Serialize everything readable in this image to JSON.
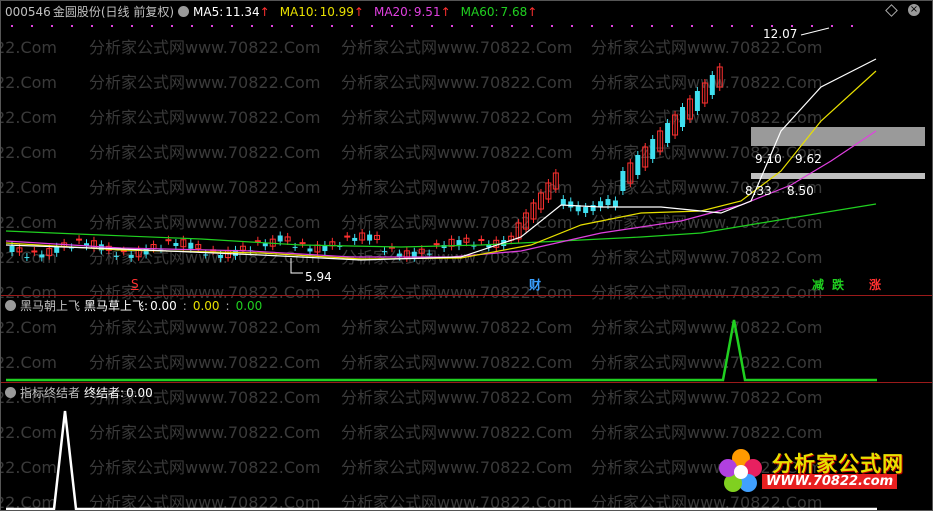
{
  "header": {
    "code": "000546",
    "name": "金圆股份",
    "period": "(日线 前复权)",
    "ma5": {
      "label": "MA5:",
      "value": "11.34",
      "color": "#ffffff"
    },
    "ma10": {
      "label": "MA10:",
      "value": "10.99",
      "color": "#e8e000"
    },
    "ma20": {
      "label": "MA20:",
      "value": "9.51",
      "color": "#e040e0"
    },
    "ma60": {
      "label": "MA60:",
      "value": "7.68",
      "color": "#20d020"
    }
  },
  "price_pane": {
    "high_label": "12.07",
    "low_label": "5.94",
    "zone_labels": [
      "9.10",
      "9.62",
      "8.33",
      "8.50"
    ],
    "markers": {
      "s": "S",
      "cai": "财",
      "jian": "减",
      "die": "跌",
      "zhang": "涨"
    }
  },
  "indicator1": {
    "name": "黑马朝上飞",
    "line_label": "黑马草上飞:",
    "v1": "0.00",
    "v2": "0.00",
    "v3": "0.00"
  },
  "indicator2": {
    "name": "指标终结者",
    "line_label": "终结者:",
    "v1": "0.00"
  },
  "watermark": {
    "text": "分析家公式网www.70822.Com",
    "short": "22.Com"
  },
  "logo": {
    "cn": "分析家公式网",
    "url": "WWW.70822.com"
  }
}
